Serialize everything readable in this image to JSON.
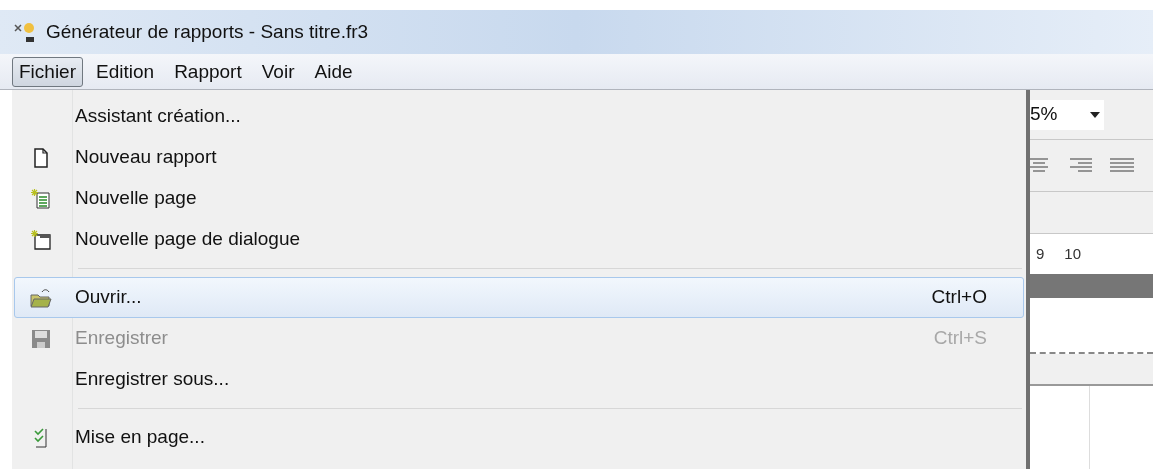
{
  "window": {
    "title": "Générateur de rapports - Sans titre.fr3"
  },
  "menubar": [
    {
      "label": "Fichier",
      "selected": true
    },
    {
      "label": "Edition",
      "selected": false
    },
    {
      "label": "Rapport",
      "selected": false
    },
    {
      "label": "Voir",
      "selected": false
    },
    {
      "label": "Aide",
      "selected": false
    }
  ],
  "menu": {
    "items": [
      {
        "kind": "item",
        "label": "Assistant création...",
        "selected": false,
        "disabled": false
      },
      {
        "kind": "item",
        "label": "Nouveau rapport",
        "selected": false,
        "disabled": false
      },
      {
        "kind": "item",
        "label": "Nouvelle page",
        "selected": false,
        "disabled": false
      },
      {
        "kind": "item",
        "label": "Nouvelle page de dialogue",
        "selected": false,
        "disabled": false
      },
      {
        "kind": "separator"
      },
      {
        "kind": "item",
        "label": "Ouvrir...",
        "shortcut": "Ctrl+O",
        "selected": true,
        "disabled": false
      },
      {
        "kind": "item",
        "label": "Enregistrer",
        "shortcut": "Ctrl+S",
        "selected": false,
        "disabled": true
      },
      {
        "kind": "item",
        "label": "Enregistrer sous...",
        "selected": false,
        "disabled": false
      },
      {
        "kind": "separator"
      },
      {
        "kind": "item",
        "label": "Mise en page...",
        "selected": false,
        "disabled": false
      }
    ]
  },
  "toolbar": {
    "zoom": "5%"
  },
  "ruler": [
    "9",
    "10"
  ]
}
